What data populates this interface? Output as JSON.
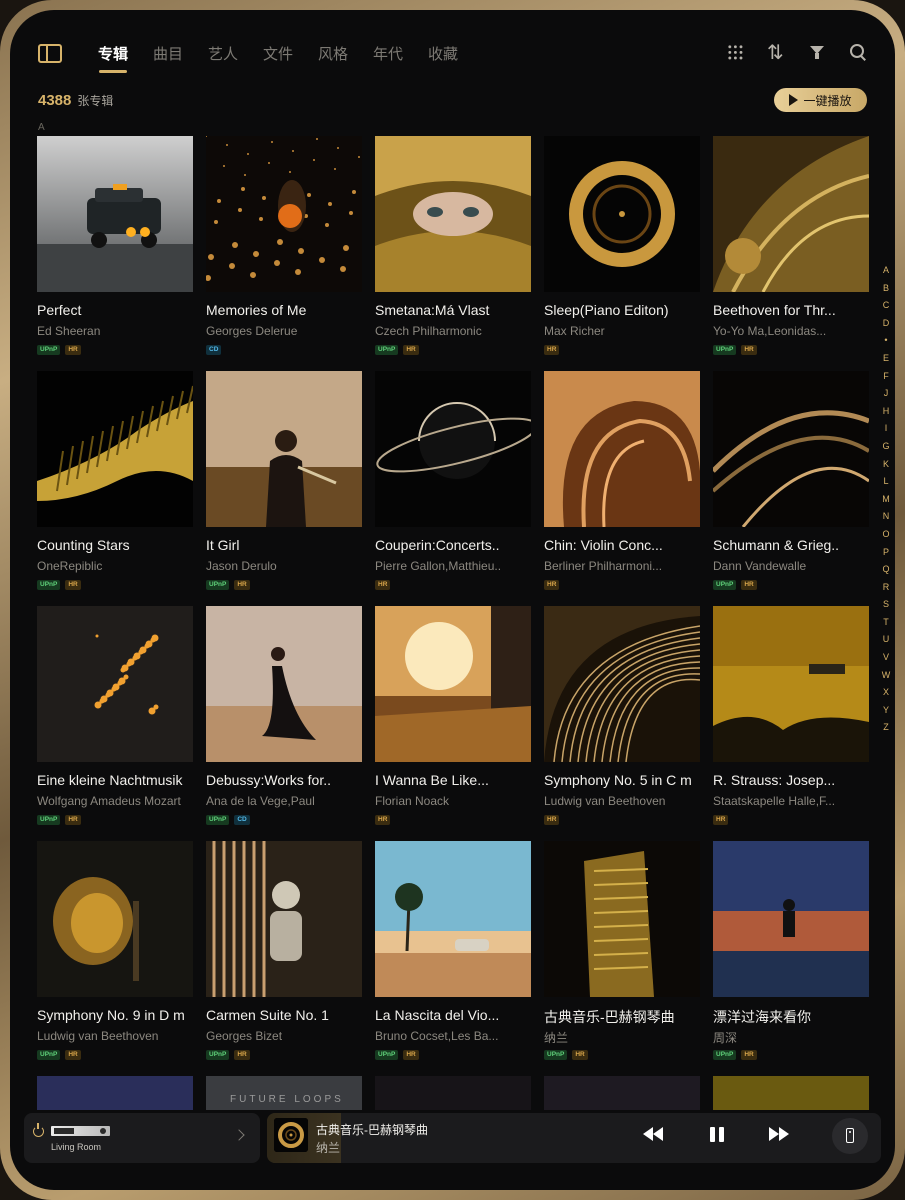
{
  "nav": {
    "tabs": [
      "专辑",
      "曲目",
      "艺人",
      "文件",
      "风格",
      "年代",
      "收藏"
    ],
    "active_tab": "专辑",
    "tool_icons": [
      "grid-view-icon",
      "sort-icon",
      "filter-icon",
      "search-icon"
    ]
  },
  "header": {
    "count": "4388",
    "count_label": "张专辑",
    "play_all_label": "一键播放",
    "section_letter": "A"
  },
  "alphabet": [
    "A",
    "B",
    "C",
    "D",
    "•",
    "E",
    "F",
    "J",
    "H",
    "I",
    "G",
    "K",
    "L",
    "M",
    "N",
    "O",
    "P",
    "Q",
    "R",
    "S",
    "T",
    "U",
    "V",
    "W",
    "X",
    "Y",
    "Z"
  ],
  "albums": [
    {
      "title": "Perfect",
      "artist": "Ed Sheeran",
      "badges": [
        "UPnP",
        "HR"
      ]
    },
    {
      "title": "Memories of Me",
      "artist": "Georges Delerue",
      "badges": [
        "CD"
      ]
    },
    {
      "title": "Smetana:Má Vlast",
      "artist": "Czech Philharmonic",
      "badges": [
        "UPnP",
        "HR"
      ]
    },
    {
      "title": "Sleep(Piano Editon)",
      "artist": "Max Richer",
      "badges": [
        "HR"
      ]
    },
    {
      "title": "Beethoven for Thr...",
      "artist": "Yo-Yo Ma,Leonidas...",
      "badges": [
        "UPnP",
        "HR"
      ]
    },
    {
      "title": "Counting Stars",
      "artist": "OneRepiblic",
      "badges": [
        "UPnP",
        "HR"
      ]
    },
    {
      "title": "It Girl",
      "artist": "Jason Derulo",
      "badges": [
        "UPnP",
        "HR"
      ]
    },
    {
      "title": "Couperin:Concerts..",
      "artist": "Pierre Gallon,Matthieu..",
      "badges": [
        "HR"
      ]
    },
    {
      "title": "Chin: Violin Conc...",
      "artist": "Berliner Philharmoni...",
      "badges": [
        "HR"
      ]
    },
    {
      "title": "Schumann & Grieg..",
      "artist": "Dann Vandewalle",
      "badges": [
        "UPnP",
        "HR"
      ]
    },
    {
      "title": "Eine kleine Nachtmusik",
      "artist": "Wolfgang Amadeus Mozart",
      "badges": [
        "UPnP",
        "HR"
      ]
    },
    {
      "title": "Debussy:Works for..",
      "artist": "Ana de la Vege,Paul",
      "badges": [
        "UPnP",
        "CD"
      ]
    },
    {
      "title": "I Wanna Be Like...",
      "artist": "Florian Noack",
      "badges": [
        "HR"
      ]
    },
    {
      "title": "Symphony No. 5 in C m",
      "artist": "Ludwig van Beethoven",
      "badges": [
        "HR"
      ]
    },
    {
      "title": "R. Strauss: Josep...",
      "artist": "Staatskapelle Halle,F...",
      "badges": [
        "HR"
      ]
    },
    {
      "title": "Symphony No. 9 in D m",
      "artist": "Ludwig van Beethoven",
      "badges": [
        "UPnP",
        "HR"
      ]
    },
    {
      "title": "Carmen Suite No. 1",
      "artist": "Georges Bizet",
      "badges": [
        "UPnP",
        "HR"
      ]
    },
    {
      "title": "La Nascita del Vio...",
      "artist": "Bruno Cocset,Les Ba...",
      "badges": [
        "UPnP",
        "HR"
      ]
    },
    {
      "title": "古典音乐-巴赫钢琴曲",
      "artist": "纳兰",
      "badges": [
        "UPnP",
        "HR"
      ]
    },
    {
      "title": "漂洋过海来看你",
      "artist": "周深",
      "badges": [
        "UPnP",
        "HR"
      ]
    }
  ],
  "partial_row_text": "FUTURE LOOPS",
  "player": {
    "room_name": "Living Room",
    "now_title": "古典音乐-巴赫钢琴曲",
    "now_artist": "纳兰",
    "progress": 0.12
  },
  "colors": {
    "accent_gold": "#d7b36a",
    "background": "#0b0b0c",
    "badge_upnp": "#5fd17a",
    "badge_hr": "#d7a54a",
    "badge_cd": "#53b8e8"
  }
}
